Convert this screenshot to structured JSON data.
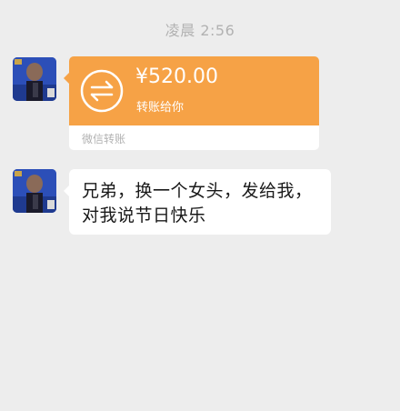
{
  "timestamp": "凌晨 2:56",
  "transfer": {
    "amount": "¥520.00",
    "note": "转账给你",
    "footer": "微信转账",
    "color": "#f6a246"
  },
  "message": {
    "line1": "兄弟，换一个女头，发给我，",
    "line2": "对我说节日快乐"
  },
  "icons": {
    "avatar": "avatar-photo",
    "transfer": "transfer-arrows-icon"
  }
}
